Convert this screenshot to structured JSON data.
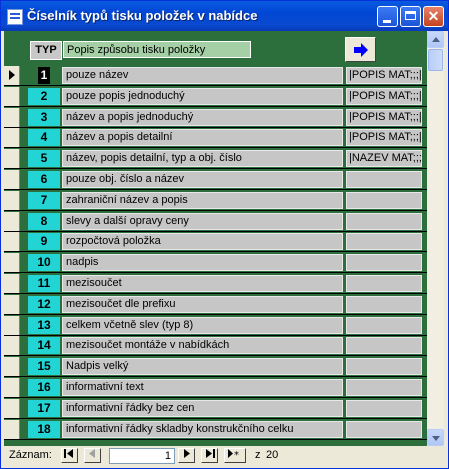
{
  "window": {
    "title": "Číselník typů tisku položek v nabídce",
    "minimize_icon": "minimize-icon",
    "maximize_icon": "maximize-icon",
    "close_icon": "close-icon",
    "close_label": "✕"
  },
  "header": {
    "typ_label": "TYP",
    "popis_label": "Popis způsobu tisku položky",
    "arrow_icon": "arrow-right-icon",
    "arrow_color": "#0000ff"
  },
  "colors": {
    "form_background": "#2d6f3c",
    "number_cell": "#22d4d4",
    "field_gray": "#c6c6c6",
    "titlebar_blue": "#0a5be0"
  },
  "rows": [
    {
      "num": "1",
      "name": "pouze název",
      "code": "|POPIS MAT;;;|",
      "selected": true
    },
    {
      "num": "2",
      "name": "pouze popis jednoduchý",
      "code": "|POPIS MAT;;;|"
    },
    {
      "num": "3",
      "name": "název a popis jednoduchý",
      "code": "|POPIS MAT;;;|"
    },
    {
      "num": "4",
      "name": "název a popis detailní",
      "code": "|POPIS MAT;;;|"
    },
    {
      "num": "5",
      "name": "název, popis detailní, typ a obj. číslo",
      "code": "|NAZEV MAT;;;|"
    },
    {
      "num": "6",
      "name": "pouze obj. číslo a název",
      "code": ""
    },
    {
      "num": "7",
      "name": "zahraniční název a popis",
      "code": ""
    },
    {
      "num": "8",
      "name": "slevy a další opravy ceny",
      "code": ""
    },
    {
      "num": "9",
      "name": "rozpočtová položka",
      "code": ""
    },
    {
      "num": "10",
      "name": "nadpis",
      "code": ""
    },
    {
      "num": "11",
      "name": "mezisoučet",
      "code": ""
    },
    {
      "num": "12",
      "name": "mezisoučet dle prefixu",
      "code": ""
    },
    {
      "num": "13",
      "name": "celkem včetně slev (typ 8)",
      "code": ""
    },
    {
      "num": "14",
      "name": "mezisoučet montáže v nabídkách",
      "code": ""
    },
    {
      "num": "15",
      "name": "Nadpis velký",
      "code": ""
    },
    {
      "num": "16",
      "name": "informativní text",
      "code": ""
    },
    {
      "num": "17",
      "name": "informativní řádky bez cen",
      "code": ""
    },
    {
      "num": "18",
      "name": "informativní řádky skladby konstrukčního celku",
      "code": ""
    }
  ],
  "navigation": {
    "record_label": "Záznam:",
    "current_record": "1",
    "of_label": "z",
    "total_records": "20",
    "first_icon": "first-record-icon",
    "prev_icon": "previous-record-icon",
    "next_icon": "next-record-icon",
    "last_icon": "last-record-icon",
    "new_icon": "new-record-icon"
  },
  "scrollbar": {
    "up_icon": "scroll-up-icon",
    "down_icon": "scroll-down-icon"
  }
}
